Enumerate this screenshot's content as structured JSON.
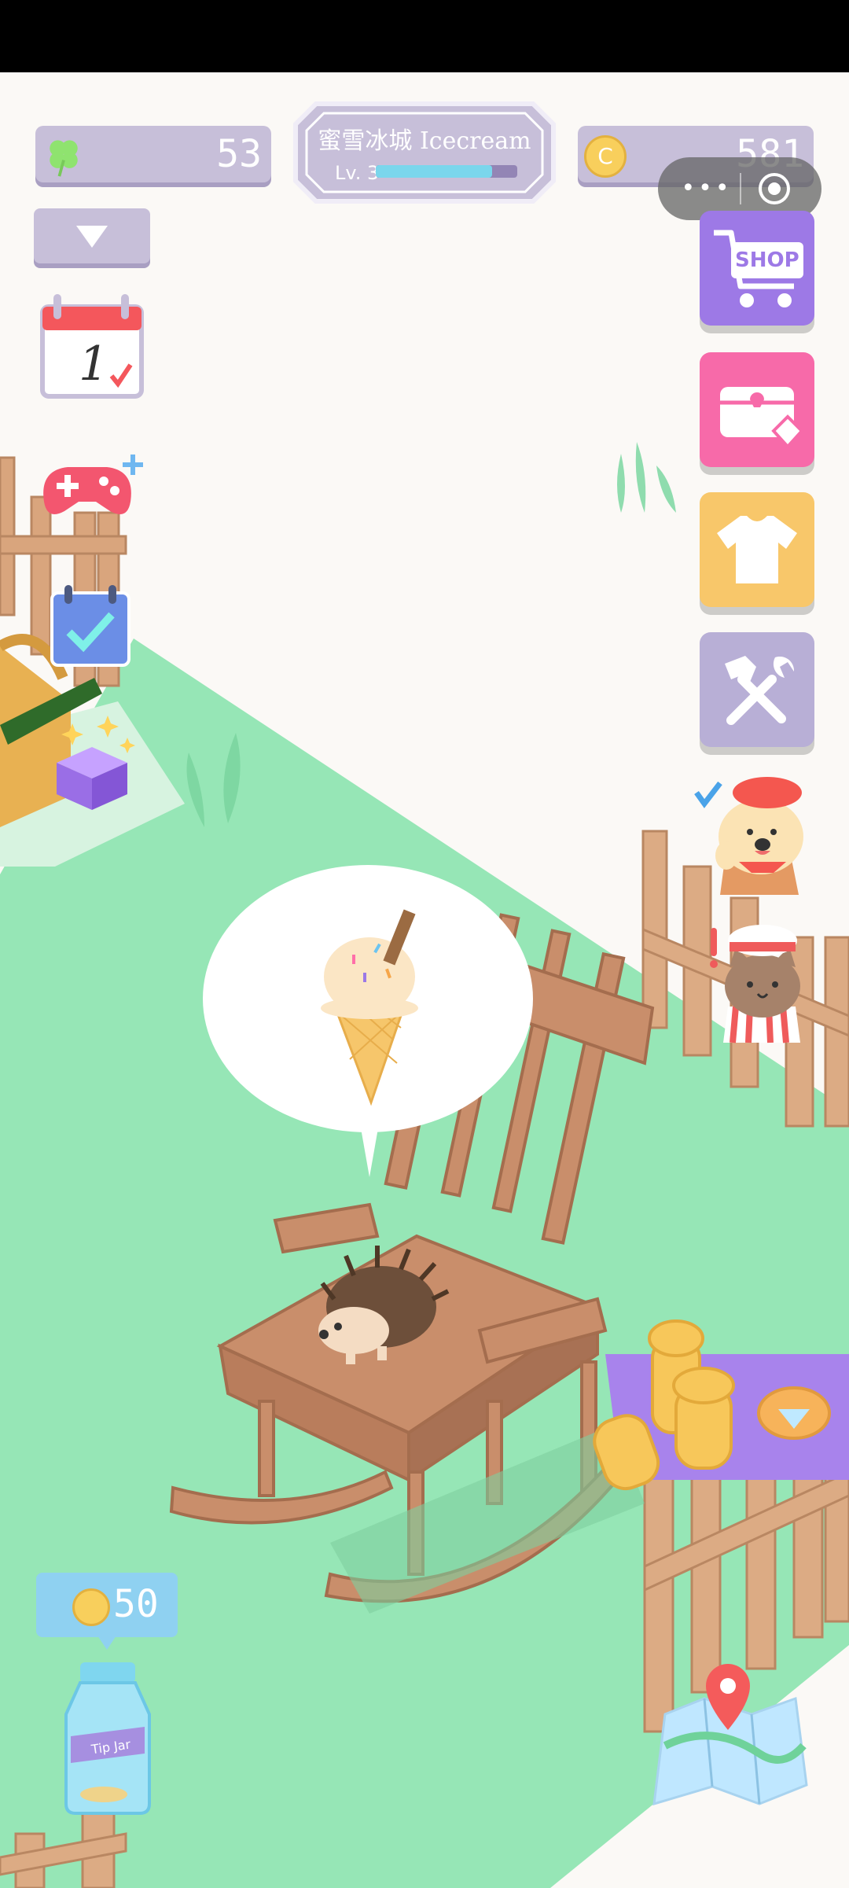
{
  "hud": {
    "clover_count": "53",
    "coin_count": "581",
    "shop_name": "蜜雪冰城 Icecream",
    "level_label": "Lv. 3",
    "level_progress": 0.82
  },
  "menu": {
    "more_label": "•••"
  },
  "calendar": {
    "day": "1"
  },
  "side_buttons": {
    "shop_label": "SHOP"
  },
  "tip_jar": {
    "amount": "50",
    "jar_label": "Tip Jar"
  },
  "colors": {
    "grass": "#96e6b6",
    "shop_purple": "#9d79e6",
    "chest_pink": "#f76aa9",
    "shirt_yellow": "#f8c76a",
    "tools_lavender": "#b8afd6",
    "hud_lavender": "#c7bfd9"
  }
}
